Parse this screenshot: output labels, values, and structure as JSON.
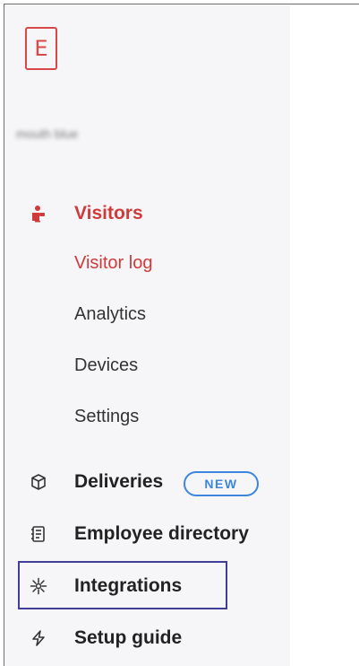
{
  "logo": {
    "glyph": "E"
  },
  "workspace": {
    "name": "mouth blue"
  },
  "nav": {
    "visitors": {
      "label": "Visitors",
      "sub_items": [
        "Visitor log",
        "Analytics",
        "Devices",
        "Settings"
      ]
    },
    "deliveries": {
      "label": "Deliveries",
      "badge": "NEW"
    },
    "employee_directory": {
      "label": "Employee directory"
    },
    "integrations": {
      "label": "Integrations"
    },
    "setup_guide": {
      "label": "Setup guide"
    }
  },
  "colors": {
    "brand_red": "#d94848",
    "active_red": "#cf3a3a",
    "badge_blue": "#3c86e0",
    "highlight_border": "#3f3f9a",
    "sidebar_bg": "#f6f6f8"
  },
  "icons": {
    "visitors": "person-badge-icon",
    "deliveries": "package-icon",
    "employee_directory": "directory-icon",
    "integrations": "integrations-icon",
    "setup_guide": "lightning-icon"
  }
}
